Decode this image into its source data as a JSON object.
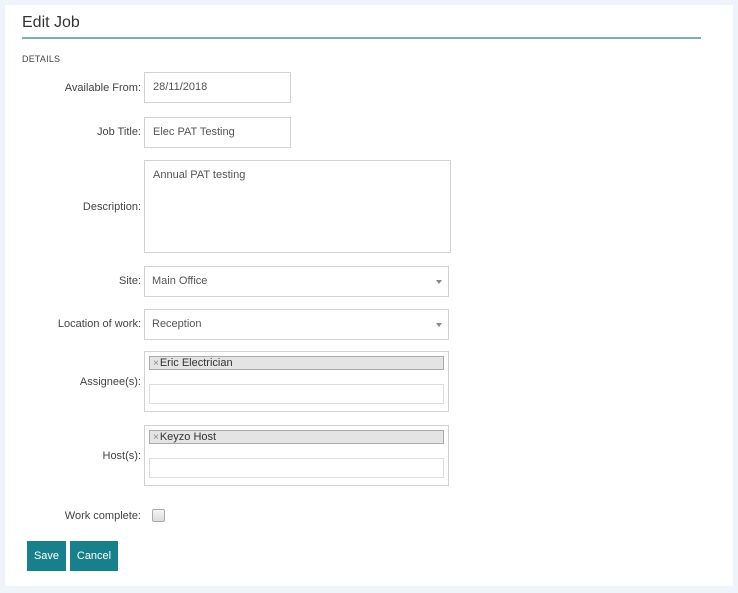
{
  "page": {
    "title": "Edit Job",
    "section_label": "DETAILS"
  },
  "form": {
    "available_from": {
      "label": "Available From:",
      "value": "28/11/2018"
    },
    "job_title": {
      "label": "Job Title:",
      "value": "Elec PAT Testing"
    },
    "description": {
      "label": "Description:",
      "value": "Annual PAT testing"
    },
    "site": {
      "label": "Site:",
      "value": "Main Office"
    },
    "location": {
      "label": "Location of work:",
      "value": "Reception"
    },
    "assignees": {
      "label": "Assignee(s):",
      "tags": [
        "Eric Electrician"
      ],
      "remove_glyph": "×"
    },
    "hosts": {
      "label": "Host(s):",
      "tags": [
        "Keyzo Host"
      ],
      "remove_glyph": "×"
    },
    "work_complete": {
      "label": "Work complete:",
      "checked": false
    }
  },
  "actions": {
    "save_label": "Save",
    "cancel_label": "Cancel"
  },
  "colors": {
    "accent": "#17808a",
    "title_rule": "#7fadb0",
    "background": "#eef4fa"
  }
}
